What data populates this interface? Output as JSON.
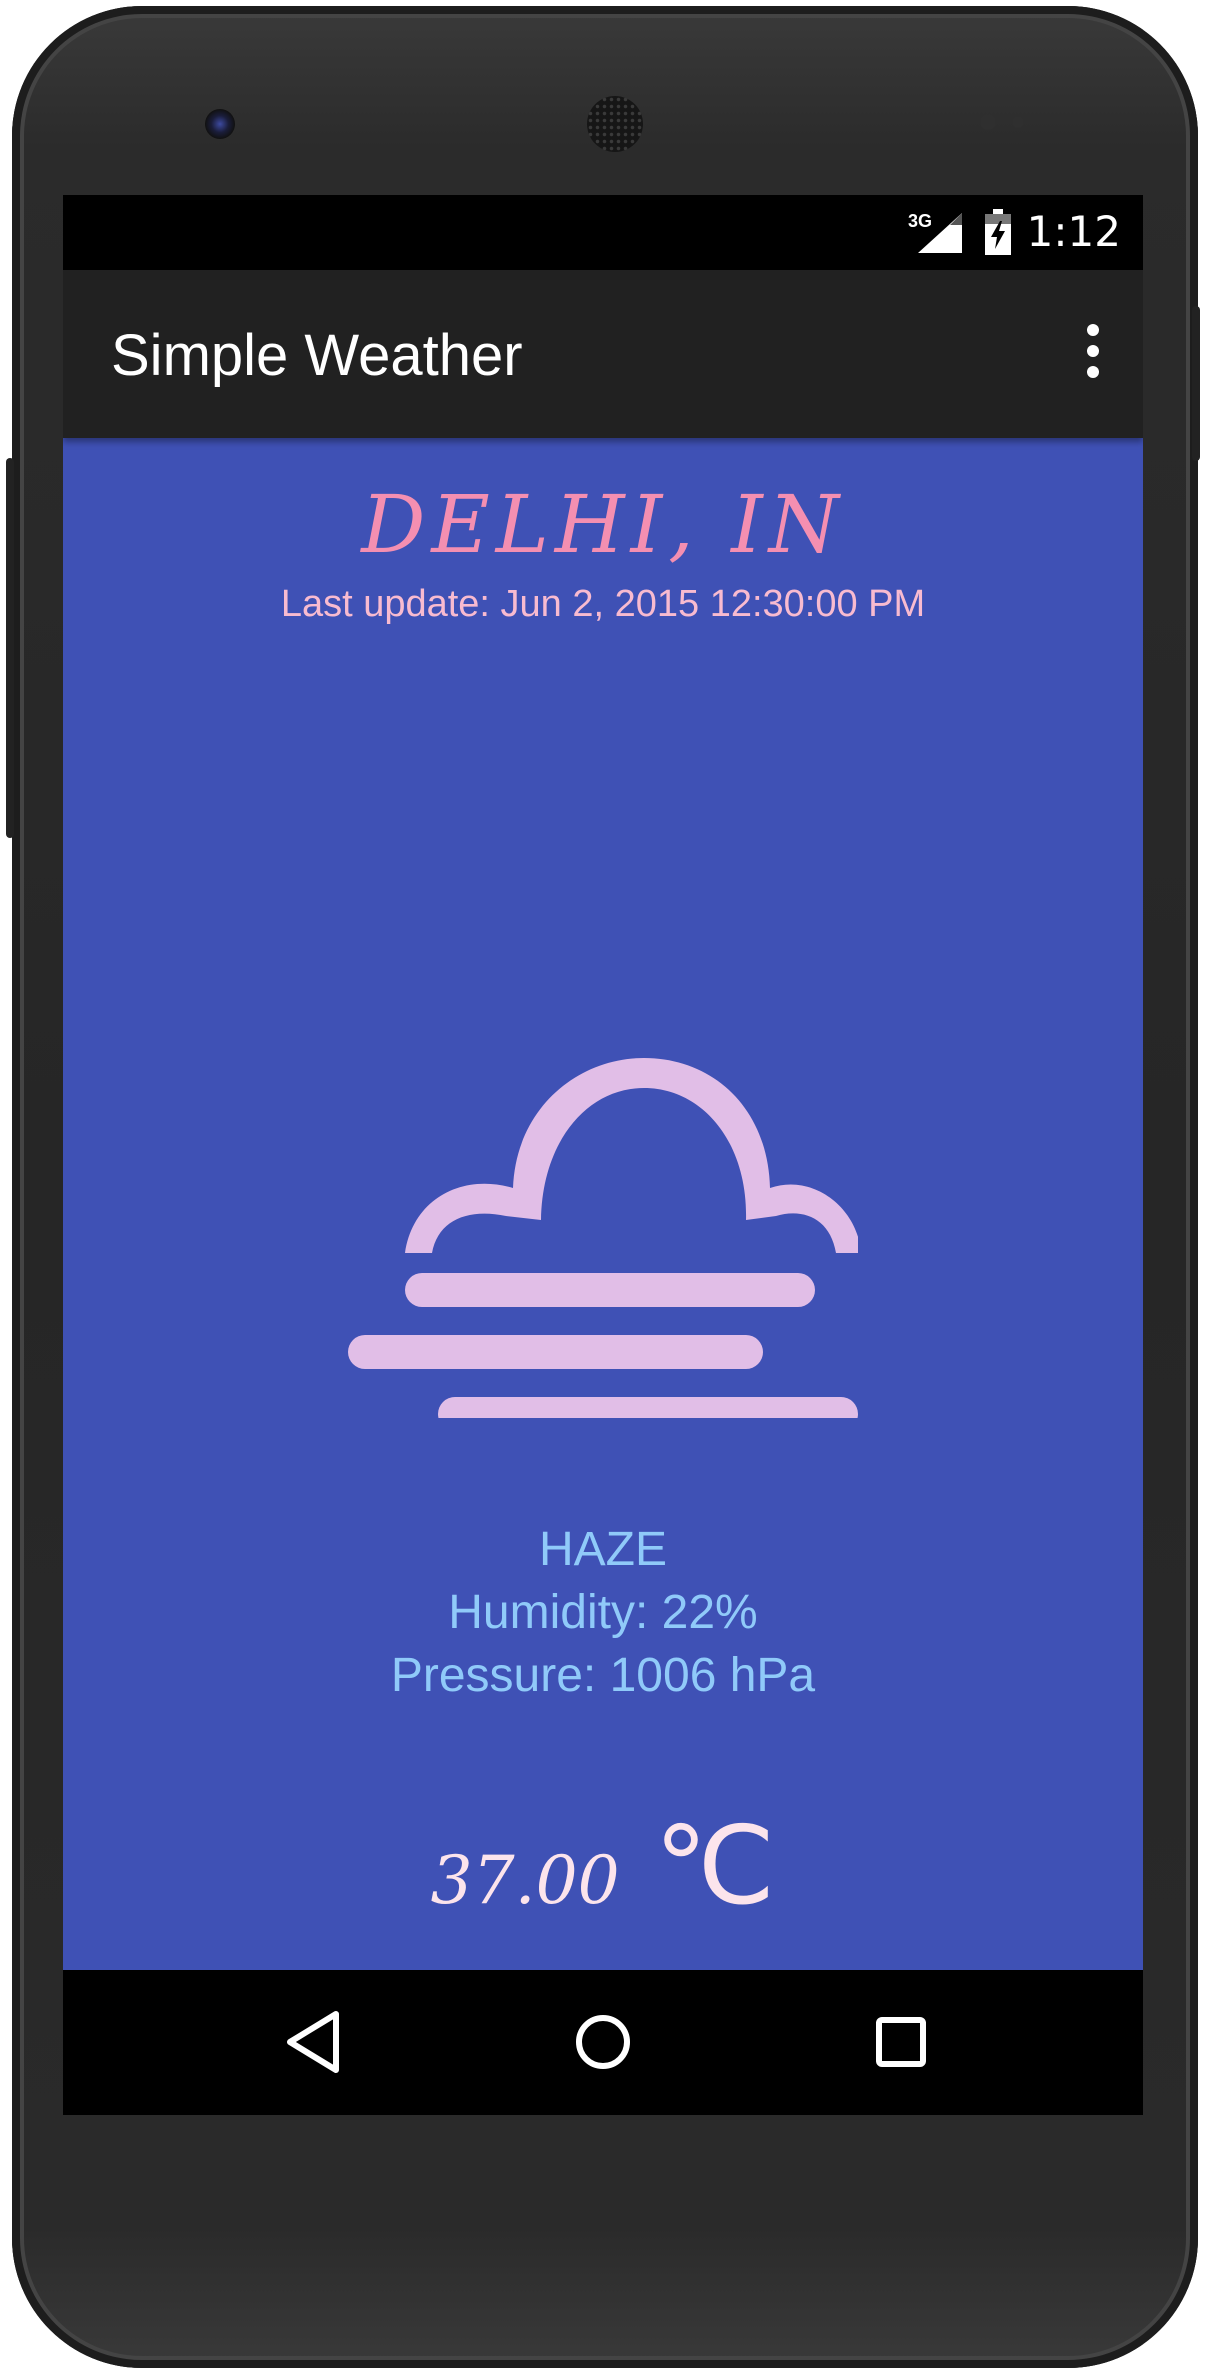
{
  "status_bar": {
    "network_type": "3G",
    "time": "1:12",
    "icons": [
      "signal-icon",
      "battery-charging-icon"
    ]
  },
  "app_bar": {
    "title": "Simple Weather",
    "menu_icon": "overflow-menu-icon"
  },
  "weather": {
    "city": "DELHI, IN",
    "last_update": "Last update: Jun 2, 2015 12:30:00 PM",
    "condition_icon": "haze-icon",
    "condition": "HAZE",
    "humidity": "Humidity: 22%",
    "pressure": "Pressure: 1006 hPa",
    "temperature": "37.00",
    "unit": "℃"
  },
  "nav_bar": {
    "icons": [
      "back-icon",
      "home-icon",
      "recents-icon"
    ]
  },
  "colors": {
    "content_bg": "#3f51b5",
    "app_bar_bg": "#212121",
    "city_text": "#f48fb1",
    "update_text": "#f8bbd0",
    "details_text": "#90caf9",
    "icon_fill": "#e1bee7",
    "temp_text": "#fce4ec"
  }
}
